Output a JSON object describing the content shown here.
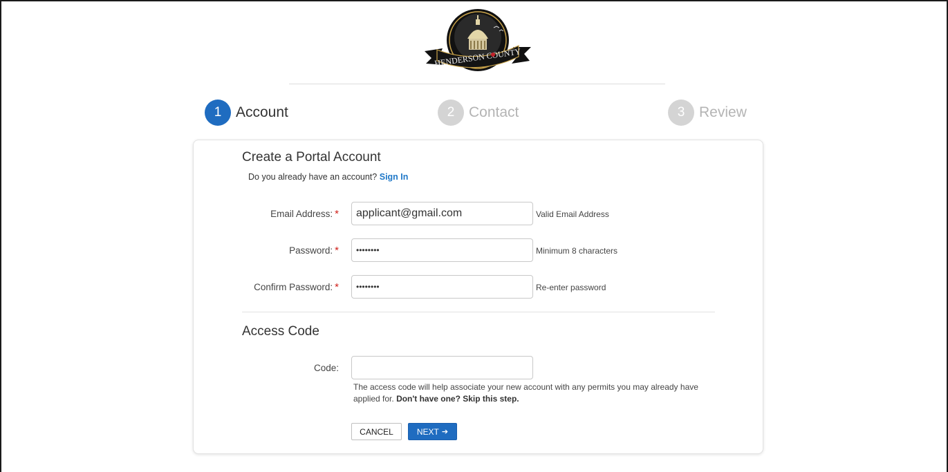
{
  "logo": {
    "name": "henderson-county-seal",
    "text": "HENDERSON COUNTY"
  },
  "steps": [
    {
      "number": "1",
      "label": "Account"
    },
    {
      "number": "2",
      "label": "Contact"
    },
    {
      "number": "3",
      "label": "Review"
    }
  ],
  "account": {
    "title": "Create a Portal Account",
    "signin_prompt": "Do you already have an account?",
    "signin_link": "Sign In",
    "fields": [
      {
        "label": "Email Address:",
        "value": "applicant@gmail.com",
        "hint": "Valid Email Address"
      },
      {
        "label": "Password:",
        "value": "••••••••",
        "hint": "Minimum 8 characters"
      },
      {
        "label": "Confirm Password:",
        "value": "••••••••",
        "hint": "Re-enter password"
      }
    ],
    "required_marker": "*"
  },
  "access_code": {
    "title": "Access Code",
    "label": "Code:",
    "value": "",
    "help": "The access code will help associate your new account with any permits you may already have applied for.",
    "help_bold": "Don't have one? Skip this step."
  },
  "buttons": {
    "cancel": "CANCEL",
    "next": "NEXT",
    "next_arrow": "➔"
  },
  "colors": {
    "accent": "#1f6cc0",
    "link": "#1f78c8",
    "required": "#d0201a",
    "inactive_step": "#d4d4d4"
  }
}
